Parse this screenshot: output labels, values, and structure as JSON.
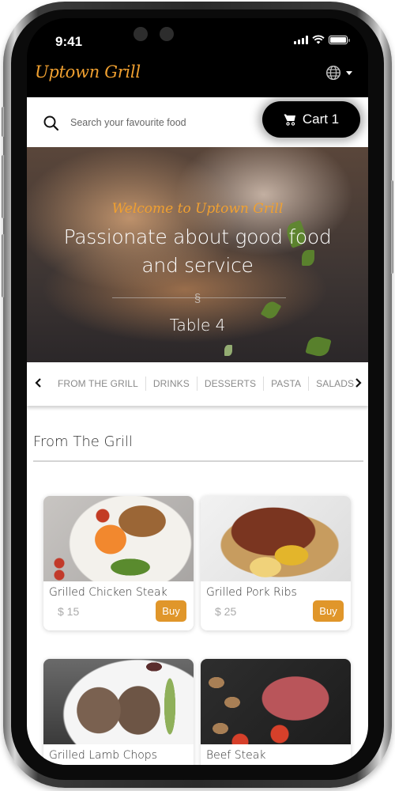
{
  "status_bar": {
    "time": "9:41",
    "icons": [
      "signal-icon",
      "wifi-icon",
      "battery-icon"
    ]
  },
  "header": {
    "brand": "Uptown Grill",
    "language_icon": "globe-icon",
    "language_caret_icon": "caret-down-icon"
  },
  "search": {
    "placeholder": "Search your favourite food",
    "value": "",
    "icon": "search-icon"
  },
  "cart": {
    "label": "Cart 1",
    "icon": "cart-icon",
    "count": 1
  },
  "hero": {
    "welcome": "Welcome to Uptown Grill",
    "title": "Passionate about good food and service",
    "divider_mark": "§",
    "table": "Table 4"
  },
  "categories": {
    "prev_icon": "chevron-left-icon",
    "next_icon": "chevron-right-icon",
    "items": [
      {
        "label": "FROM THE GRILL"
      },
      {
        "label": "DRINKS"
      },
      {
        "label": "DESSERTS"
      },
      {
        "label": "PASTA"
      },
      {
        "label": "SALADS"
      }
    ]
  },
  "section": {
    "title": "From The Grill"
  },
  "products": [
    {
      "name": "Grilled Chicken Steak",
      "price": "$ 15",
      "buy_label": "Buy"
    },
    {
      "name": "Grilled Pork Ribs",
      "price": "$ 25",
      "buy_label": "Buy"
    },
    {
      "name": "Grilled Lamb Chops",
      "price": "",
      "buy_label": ""
    },
    {
      "name": "Beef Steak",
      "price": "",
      "buy_label": ""
    }
  ],
  "colors": {
    "accent": "#e0962a",
    "brand": "#f0a030",
    "header_bg": "#000000"
  }
}
